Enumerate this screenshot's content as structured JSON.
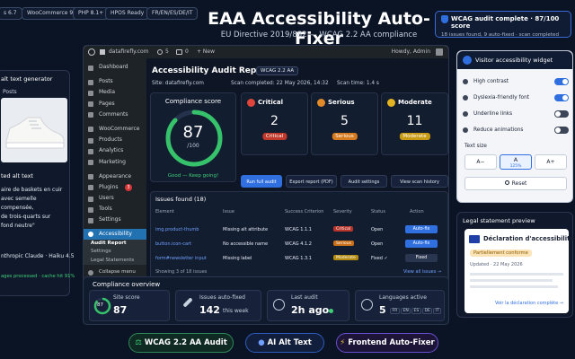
{
  "top_pills": [
    "s 6.7",
    "WooCommerce 9",
    "PHP 8.1+",
    "HPOS Ready",
    "FR/EN/ES/DE/IT"
  ],
  "hero": {
    "title": "EAA Accessibility Auto-Fixer",
    "subtitle": "EU Directive 2019/882 — WCAG 2.2 AA compliance"
  },
  "toast": {
    "title": "WCAG audit complete · 87/100 score",
    "body": "18 issues found, 9 auto-fixed · scan completed"
  },
  "alt_card": {
    "title": "alt text generator",
    "section": "Posts",
    "label": "ted alt text",
    "text_lines": [
      "aire de baskets en cuir",
      "avec semelle compensée,",
      "de trois-quarts sur",
      "fond neutre\""
    ],
    "model": "nthropic Claude · Haiku 4.5",
    "status": "ages processed · cache hit 91%"
  },
  "admin": {
    "bar_site": "datafirefly.com",
    "bar_count": "5",
    "bar_comments": "0",
    "bar_new": "+ New",
    "bar_user": "Howdy, Admin",
    "menu": [
      "Dashboard",
      "Posts",
      "Media",
      "Pages",
      "Comments",
      "WooCommerce",
      "Products",
      "Analytics",
      "Marketing",
      "Appearance",
      "Plugins",
      "Users",
      "Tools",
      "Settings",
      "Accessibility"
    ],
    "plugins_badge": "3",
    "submenu": [
      "Audit Report",
      "Settings",
      "Legal Statements"
    ],
    "collapse": "Collapse menu"
  },
  "report": {
    "title": "Accessibility Audit Report",
    "badge": "WCAG 2.2 AA",
    "site": "Site: datafirefly.com",
    "completed": "Scan completed: 22 May 2026, 14:32",
    "time": "Scan time: 1.4 s",
    "score_title": "Compliance score",
    "score": "87",
    "score_max": "/100",
    "score_note": "Good — Keep going!",
    "metrics": [
      {
        "title": "Critical",
        "value": "2",
        "tag": "Critical"
      },
      {
        "title": "Serious",
        "value": "5",
        "tag": "Serious"
      },
      {
        "title": "Moderate",
        "value": "11",
        "tag": "Moderate"
      }
    ],
    "buttons": [
      "Run full audit",
      "Export report (PDF)",
      "Audit settings",
      "View scan history"
    ],
    "issues_title": "Issues found (18)",
    "columns": [
      "Element",
      "Issue",
      "Success Criterion",
      "Severity",
      "Status",
      "Action"
    ],
    "rows": [
      {
        "element": "img.product-thumb",
        "issue": "Missing alt attribute",
        "criterion": "WCAG 1.1.1",
        "severity": "Critical",
        "status": "Open",
        "action": "Auto-fix"
      },
      {
        "element": "button.icon-cart",
        "issue": "No accessible name",
        "criterion": "WCAG 4.1.2",
        "severity": "Serious",
        "status": "Open",
        "action": "Auto-fix"
      },
      {
        "element": "form#newsletter input",
        "issue": "Missing label",
        "criterion": "WCAG 1.3.1",
        "severity": "Moderate",
        "status": "Fixed ✓",
        "action": "Fixed"
      }
    ],
    "showing": "Showing 3 of 18 issues",
    "view_all": "View all issues →"
  },
  "overview": {
    "title": "Compliance overview",
    "cards": [
      {
        "label": "Site score",
        "value": "87",
        "ring": "87"
      },
      {
        "label": "Issues auto-fixed",
        "value": "142",
        "suffix": "this week"
      },
      {
        "label": "Last audit",
        "value": "2h ago"
      },
      {
        "label": "Languages active",
        "value": "5",
        "langs": [
          "FR",
          "EN",
          "ES",
          "DE",
          "IT"
        ]
      }
    ]
  },
  "widget": {
    "title": "Visitor accessibility widget",
    "options": [
      {
        "label": "High contrast",
        "on": true
      },
      {
        "label": "Dyslexia-friendly font",
        "on": true
      },
      {
        "label": "Underline links",
        "on": false
      },
      {
        "label": "Reduce animations",
        "on": false
      }
    ],
    "text_size_label": "Text size",
    "sizes": [
      "A−",
      "A",
      "A+"
    ],
    "size_value": "125%",
    "reset": "Reset"
  },
  "legal": {
    "title": "Legal statement preview",
    "doc_title": "Déclaration d'accessibilité",
    "status": "Partiellement conforme",
    "updated": "Updated · 22 May 2026",
    "link": "Voir la déclaration complète →"
  },
  "features": [
    "WCAG 2.2 AA Audit",
    "AI Alt Text",
    "Frontend Auto-Fixer"
  ]
}
